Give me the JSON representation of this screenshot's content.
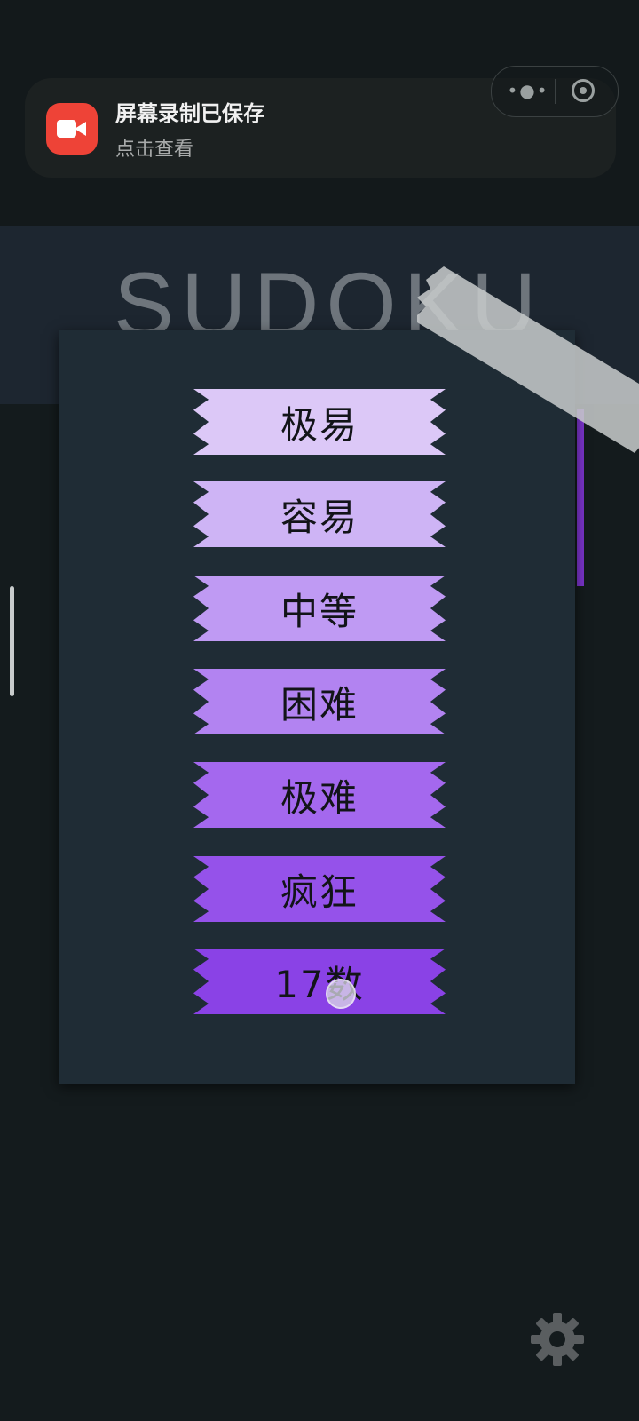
{
  "notification": {
    "title": "屏幕录制已保存",
    "subtitle": "点击查看",
    "icon": "video-camera-icon",
    "icon_color": "#ee4337"
  },
  "app": {
    "background_title": "SUDOKU"
  },
  "difficulty_levels": [
    {
      "label": "极易",
      "color": "#dcc8f7"
    },
    {
      "label": "容易",
      "color": "#ceb4f5"
    },
    {
      "label": "中等",
      "color": "#bf9af3"
    },
    {
      "label": "困难",
      "color": "#b283f1"
    },
    {
      "label": "极难",
      "color": "#a468ee"
    },
    {
      "label": "疯狂",
      "color": "#9552ea"
    },
    {
      "label": "17数",
      "color": "#8a42e6"
    }
  ],
  "settings": {
    "icon": "gear-icon"
  }
}
